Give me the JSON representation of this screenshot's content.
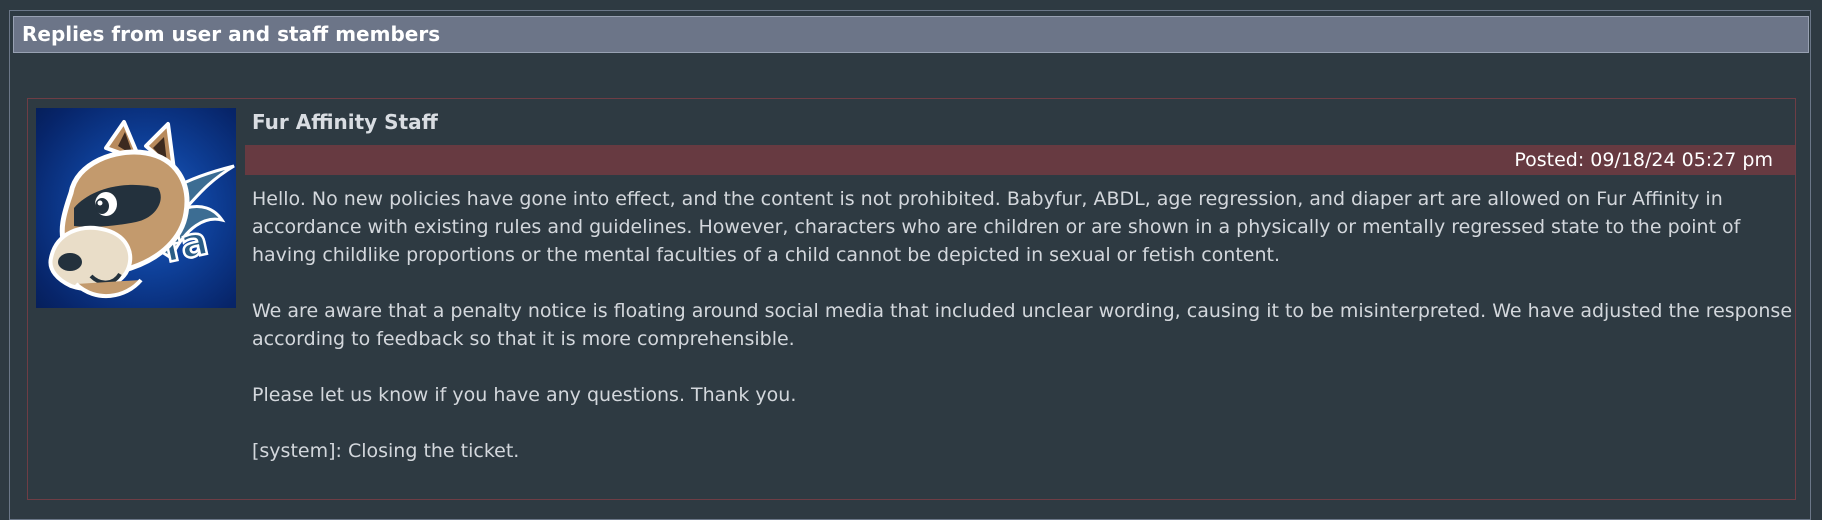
{
  "section": {
    "title": "Replies from user and staff members"
  },
  "reply": {
    "author": "Fur Affinity Staff",
    "avatar_icon": "fa-fox-mascot-icon",
    "posted": "Posted: 09/18/24 05:27 pm",
    "paragraphs": [
      "Hello. No new policies have gone into effect, and the content is not prohibited. Babyfur, ABDL, age regression, and diaper art are allowed on Fur Affinity in accordance with existing rules and guidelines. However, characters who are children or are shown in a physically or mentally regressed state to the point of having childlike proportions or the mental faculties of a child cannot be depicted in sexual or fetish content.",
      "We are aware that a penalty notice is floating around social media that included unclear wording, causing it to be misinterpreted. We have adjusted the response according to feedback so that it is more comprehensible.",
      "Please let us know if you have any questions. Thank you.",
      "[system]: Closing the ticket."
    ]
  },
  "colors": {
    "background": "#2e3a42",
    "header_bar": "#6c7588",
    "posted_bar": "#673a41",
    "reply_border": "#6e3d45"
  }
}
